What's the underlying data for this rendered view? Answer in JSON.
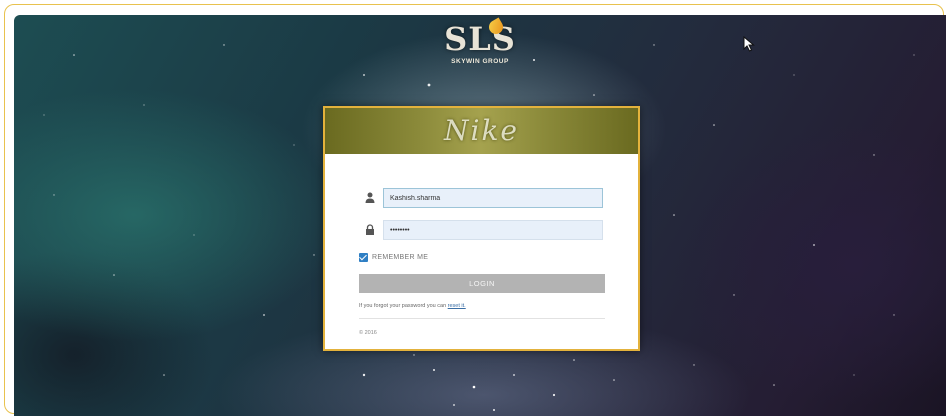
{
  "brand": {
    "logo_text": "SLS",
    "logo_subtitle": "SKYWIN GROUP"
  },
  "card": {
    "header_logo": "Nike",
    "username": {
      "value": "Kashish.sharma",
      "placeholder": ""
    },
    "password": {
      "value": "••••••••",
      "placeholder": ""
    },
    "remember_label": "REMEMBER ME",
    "login_label": "LOGIN",
    "forgot_text": "If you forgot your password you can",
    "forgot_link": "reset it.",
    "copyright": "© 2016 "
  },
  "icons": {
    "user": "user-icon",
    "lock": "lock-icon",
    "cursor": "mouse-cursor-icon"
  },
  "colors": {
    "card_border": "#e3b23c",
    "input_bg": "#e8f0fa",
    "button_bg": "#b3b3b3",
    "checkbox": "#2f7fc4"
  }
}
